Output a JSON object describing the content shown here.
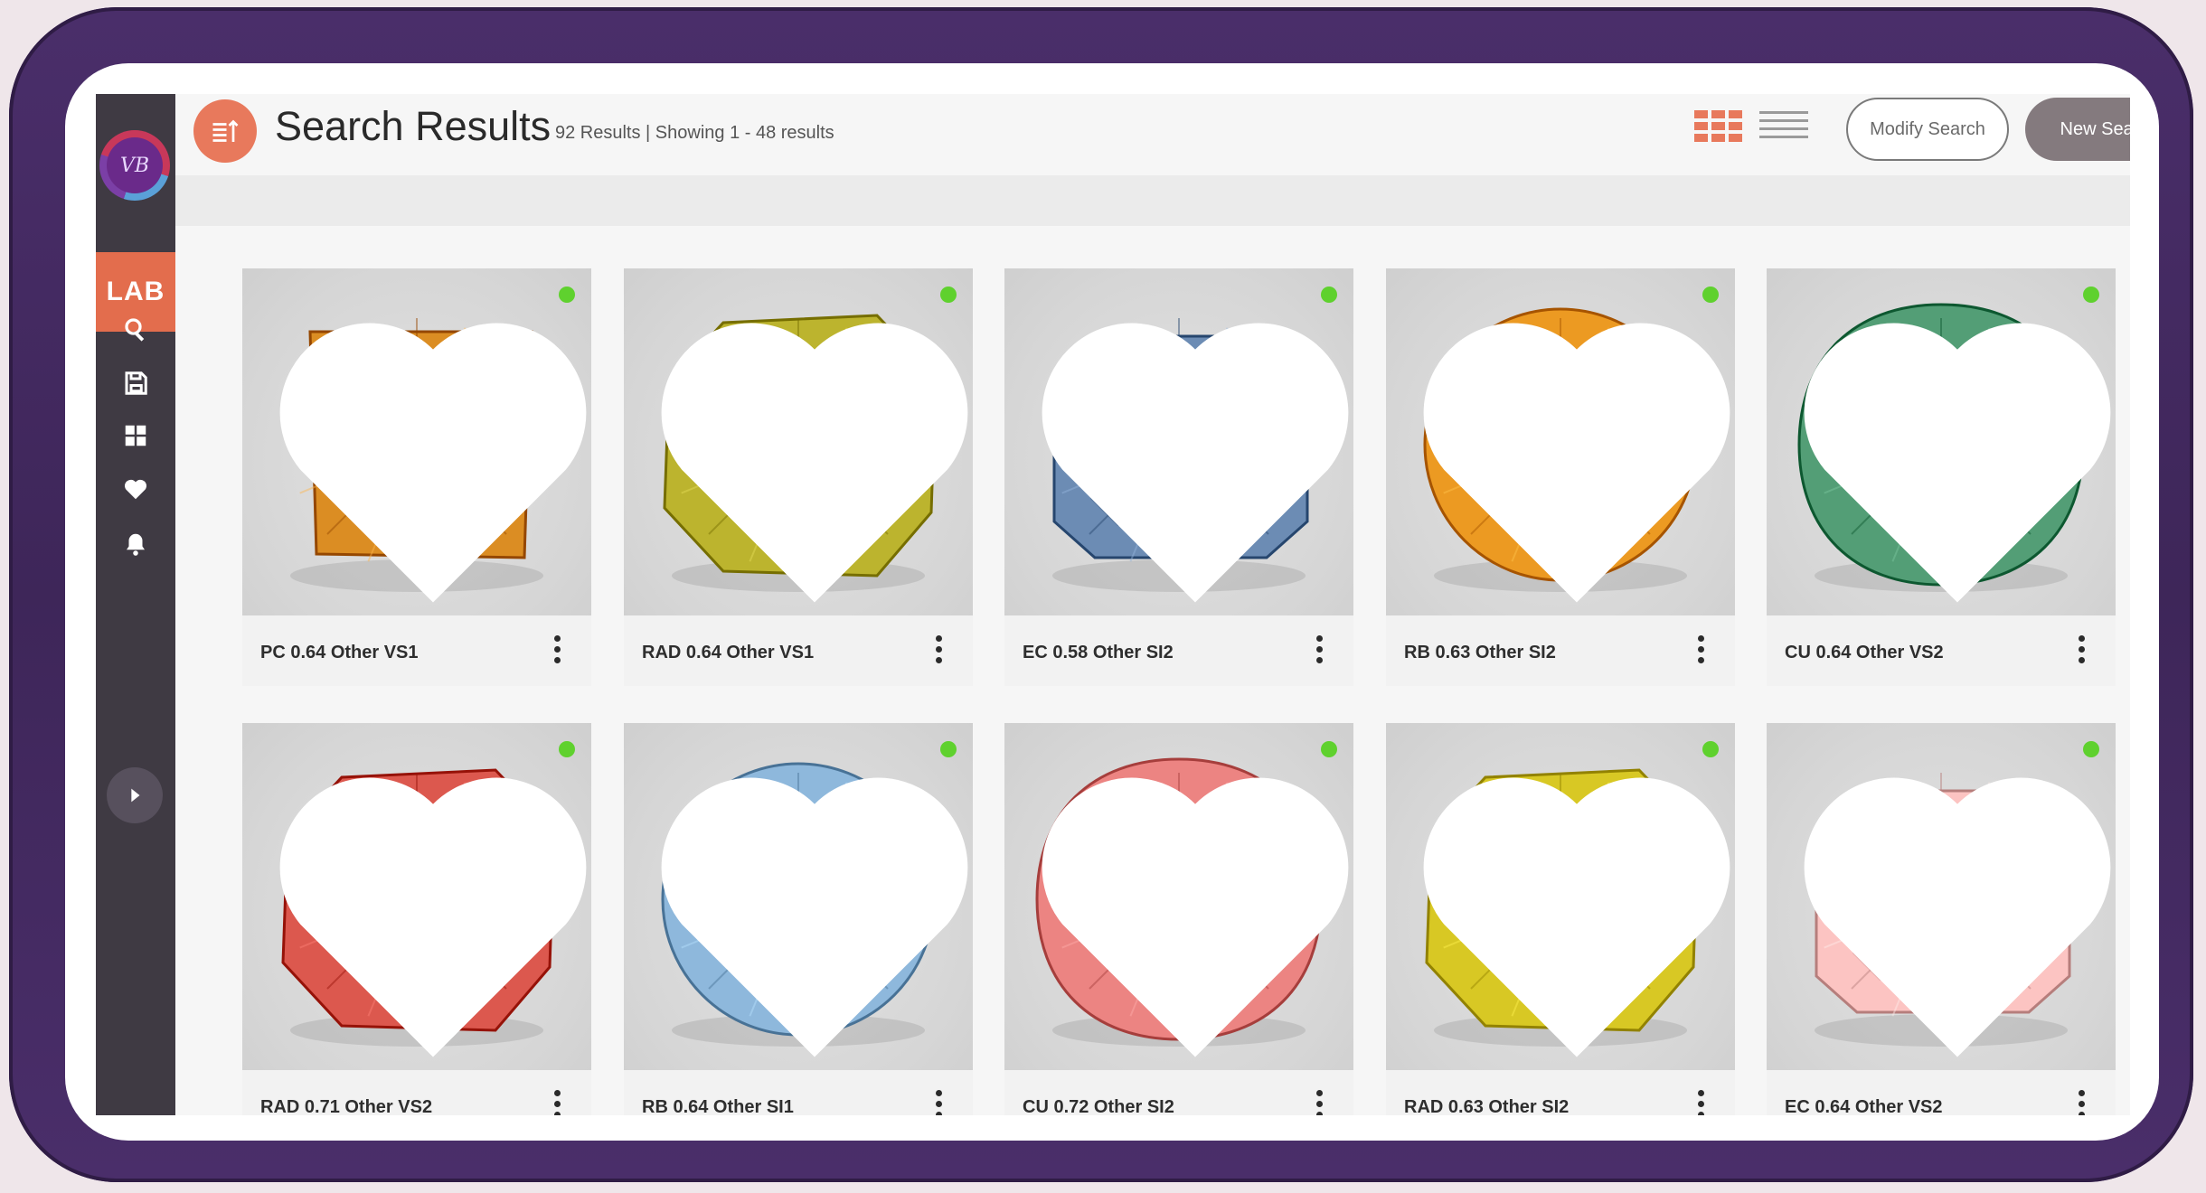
{
  "header": {
    "title": "Search Results",
    "count": "92 Results | Showing 1 - 48 results",
    "modify_label": "Modify Search",
    "new_label": "New Search"
  },
  "sidebar": {
    "brand_monogram": "VB",
    "lab_label": "LAB",
    "items": [
      {
        "icon": "search-icon"
      },
      {
        "icon": "save-icon"
      },
      {
        "icon": "dashboard-icon"
      },
      {
        "icon": "heart-icon"
      },
      {
        "icon": "bell-icon"
      }
    ]
  },
  "colors": {
    "accent": "#e8795c",
    "sidebar": "#3f3a43",
    "available_dot": "#5fd12e",
    "new_search_button": "#847a7e"
  },
  "results": [
    {
      "label": "PC 0.64 Other VS1",
      "shape": "princess",
      "color": "#c7790f",
      "available": true
    },
    {
      "label": "RAD 0.64 Other VS1",
      "shape": "radiant",
      "color": "#a8a01a",
      "available": true
    },
    {
      "label": "EC 0.58 Other SI2",
      "shape": "emerald",
      "color": "#5878a0",
      "available": true
    },
    {
      "label": "RB 0.63 Other SI2",
      "shape": "round",
      "color": "#d8860e",
      "available": true
    },
    {
      "label": "CU 0.64 Other VS2",
      "shape": "cushion",
      "color": "#3f8a62",
      "available": true
    },
    {
      "label": "RAD 0.71 Other VS2",
      "shape": "radiant",
      "color": "#c8443a",
      "available": true
    },
    {
      "label": "RB 0.64 Other SI1",
      "shape": "round",
      "color": "#7aa4c8",
      "available": true
    },
    {
      "label": "CU 0.72 Other SI2",
      "shape": "cushion",
      "color": "#d8706e",
      "available": true
    },
    {
      "label": "RAD 0.63 Other SI2",
      "shape": "radiant",
      "color": "#c4b410",
      "available": true
    },
    {
      "label": "EC 0.64 Other VS2",
      "shape": "emerald",
      "color": "#e8b0ae",
      "available": true
    }
  ]
}
